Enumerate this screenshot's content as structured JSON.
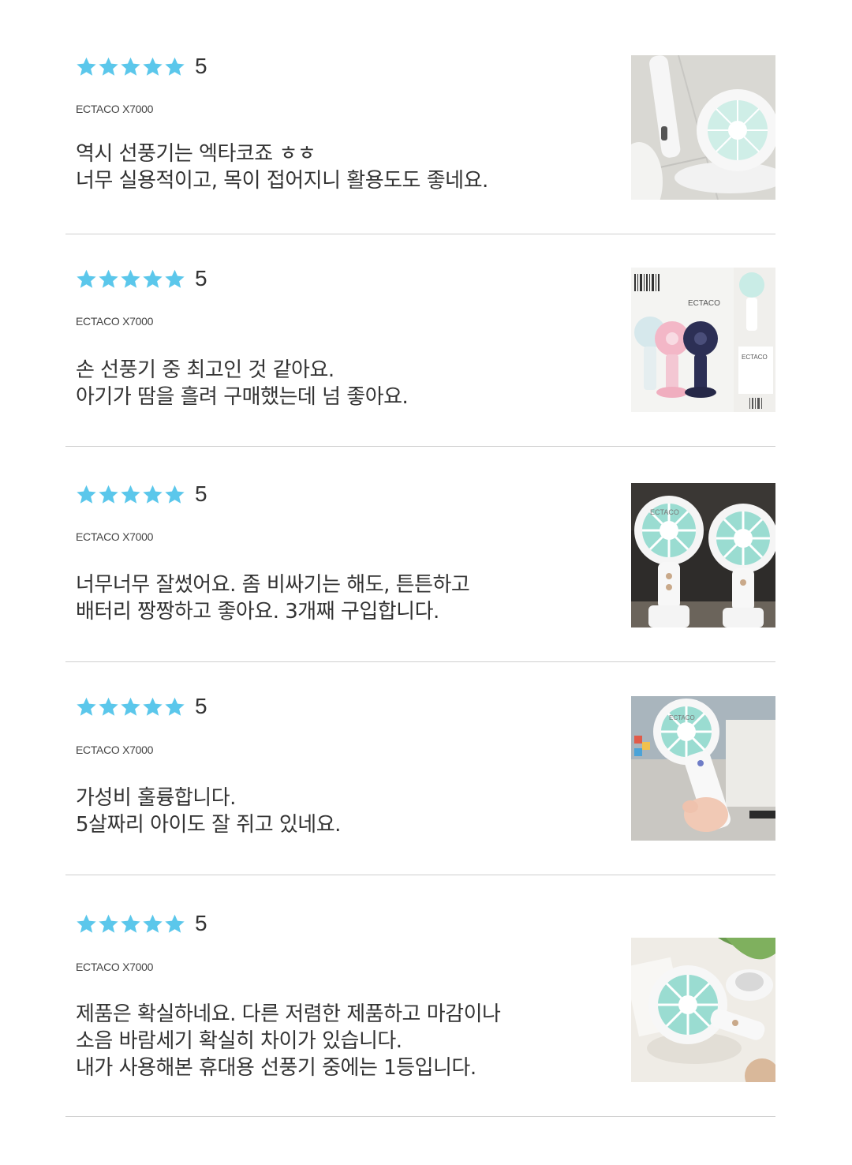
{
  "brand_color": "#5bc7eb",
  "reviews": [
    {
      "stars": 5,
      "score": "5",
      "product": "ECTACO X7000",
      "lines": [
        "역시 선풍기는 엑타코죠 ㅎㅎ",
        "너무 실용적이고, 목이 접어지니 활용도도 좋네요."
      ],
      "photo": "folded-stand-fan-photo"
    },
    {
      "stars": 5,
      "score": "5",
      "product": "ECTACO X7000",
      "lines": [
        "손 선풍기 중 최고인 것 같아요.",
        "아기가 땀을 흘려 구매했는데 넘 좋아요."
      ],
      "photo": "product-box-photo",
      "photo_text": "ECTACO"
    },
    {
      "stars": 5,
      "score": "5",
      "product": "ECTACO X7000",
      "lines": [
        "너무너무 잘썼어요. 좀 비싸기는 해도, 튼튼하고",
        "배터리 짱짱하고 좋아요. 3개째 구입합니다."
      ],
      "photo": "two-fans-on-stands-photo",
      "photo_text": "ECTACO"
    },
    {
      "stars": 5,
      "score": "5",
      "product": "ECTACO X7000",
      "lines": [
        "가성비 훌륭합니다.",
        "5살짜리 아이도 잘 쥐고 있네요."
      ],
      "photo": "hand-holding-fan-photo",
      "photo_text": "ECTACO"
    },
    {
      "stars": 5,
      "score": "5",
      "product": "ECTACO X7000",
      "lines": [
        "제품은 확실하네요. 다른 저렴한 제품하고 마감이나",
        "소음 바람세기 확실히 차이가 있습니다.",
        "내가 사용해본 휴대용 선풍기 중에는 1등입니다."
      ],
      "photo": "fan-on-table-photo"
    }
  ]
}
